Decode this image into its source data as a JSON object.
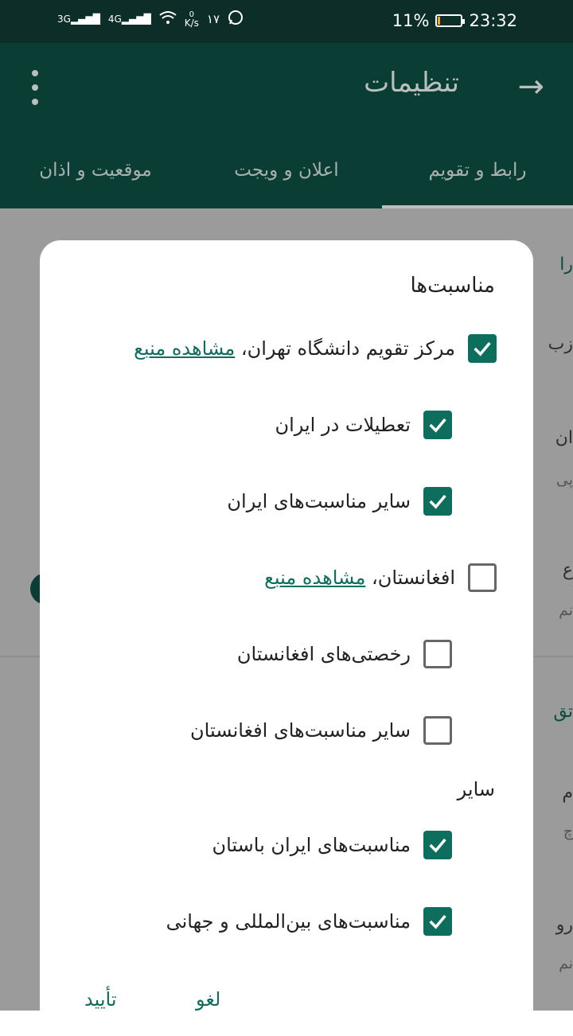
{
  "status_bar": {
    "net1": "3G",
    "net2": "4G",
    "speed_value": "0",
    "speed_unit": "K/s",
    "notif_num": "۱۷",
    "battery_percent": "11%",
    "battery_level": 0.11,
    "time": "23:32"
  },
  "appbar": {
    "title": "تنظیمات",
    "back_glyph": "→"
  },
  "tabs": [
    {
      "label": "رابط و تقویم",
      "active": true
    },
    {
      "label": "اعلان و ویجت",
      "active": false
    },
    {
      "label": "موقعیت و اذان",
      "active": false
    }
  ],
  "background": {
    "texts": [
      "را",
      "زب",
      "ان",
      "پی",
      "ع",
      "نم",
      "تق",
      "م",
      "چ",
      "رو",
      "نم"
    ]
  },
  "dialog": {
    "title": "مناسبت‌ها",
    "rows": [
      {
        "label": "مرکز تقویم دانشگاه تهران، ",
        "link": "مشاهده منبع",
        "checked": true
      },
      {
        "label": "تعطیلات در ایران",
        "link": "",
        "checked": true
      },
      {
        "label": "سایر مناسبت‌های ایران",
        "link": "",
        "checked": true
      },
      {
        "label": "افغانستان، ",
        "link": "مشاهده منبع",
        "checked": false
      },
      {
        "label": "رخصتی‌های افغانستان",
        "link": "",
        "checked": false
      },
      {
        "label": "سایر مناسبت‌های افغانستان",
        "link": "",
        "checked": false
      },
      {
        "label": "مناسبت‌های ایران باستان",
        "link": "",
        "checked": true
      },
      {
        "label": "مناسبت‌های بین‌المللی و جهانی",
        "link": "",
        "checked": true
      }
    ],
    "other_section_title": "سایر",
    "cancel_label": "لغو",
    "confirm_label": "تأیید"
  },
  "colors": {
    "accent": "#0d6e5e",
    "appbar": "#0a3d34"
  }
}
